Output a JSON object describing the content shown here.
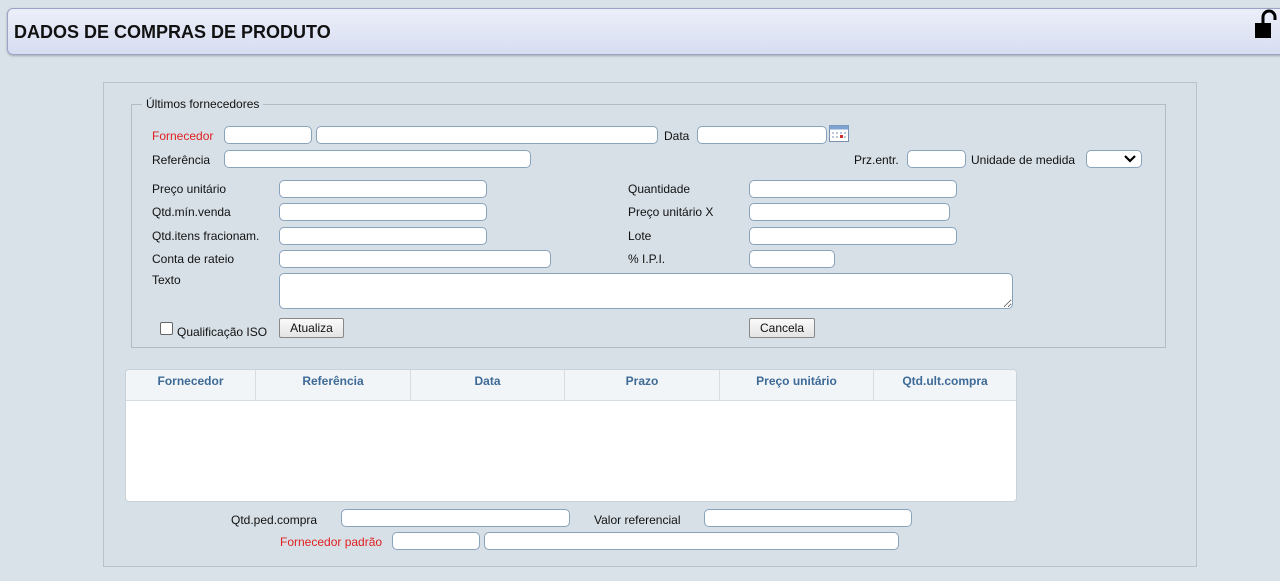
{
  "window": {
    "title": "DADOS DE COMPRAS DE PRODUTO"
  },
  "icons": {
    "lock": "unlocked-padlock-icon",
    "calendar": "calendar-icon",
    "dropdown": "chevron-down-icon"
  },
  "colors": {
    "required_label": "#e02020",
    "grid_header_text": "#3d6a96",
    "background": "#d9e2e8"
  },
  "group": {
    "legend": "Últimos fornecedores",
    "fornecedor_label": "Fornecedor",
    "data_label": "Data",
    "referencia_label": "Referência",
    "prz_entr_label": "Prz.entr.",
    "unidade_medida_label": "Unidade de medida",
    "preco_unitario_label": "Preço unitário",
    "quantidade_label": "Quantidade",
    "qtd_min_venda_label": "Qtd.mín.venda",
    "preco_unitario_x_label": "Preço unitário X",
    "qtd_itens_fracionam_label": "Qtd.itens fracionam.",
    "lote_label": "Lote",
    "conta_rateio_label": "Conta de rateio",
    "ipi_label": "% I.P.I.",
    "texto_label": "Texto",
    "qualificacao_iso_label": "Qualificação ISO",
    "atualiza_button": "Atualiza",
    "cancela_button": "Cancela"
  },
  "grid": {
    "columns": [
      "Fornecedor",
      "Referência",
      "Data",
      "Prazo",
      "Preço unitário",
      "Qtd.ult.compra"
    ],
    "rows": []
  },
  "footer": {
    "qtd_ped_compra_label": "Qtd.ped.compra",
    "valor_referencial_label": "Valor referencial",
    "fornecedor_padrao_label": "Fornecedor padrão"
  }
}
